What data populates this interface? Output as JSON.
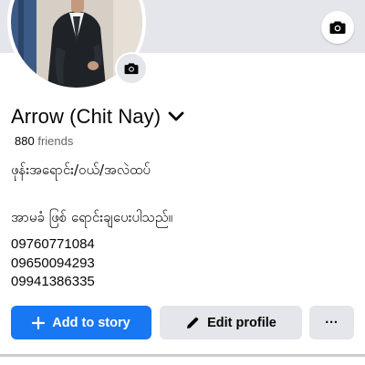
{
  "profile": {
    "name": "Arrow (Chit Nay)",
    "friends_count": "880",
    "friends_label": "friends",
    "bio_line1": "ဖုန်းအရောင်း/ဝယ်/အလဲထပ်",
    "bio_line2": "အာမခံ ဖြစ် ရောင်းချပေးပါသည်။",
    "phones": [
      "09760771084",
      "09650094293",
      "09941386335"
    ]
  },
  "actions": {
    "add_story": "Add to story",
    "edit_profile": "Edit profile",
    "more": "···"
  },
  "icons": {
    "cover_camera": "camera-icon",
    "avatar_camera": "camera-icon",
    "name_dropdown": "chevron-down-icon",
    "add_story": "plus-icon",
    "edit_profile": "pencil-icon"
  },
  "colors": {
    "primary": "#1877f2",
    "secondary_button": "#e4e6eb",
    "muted_text": "#65676b"
  }
}
